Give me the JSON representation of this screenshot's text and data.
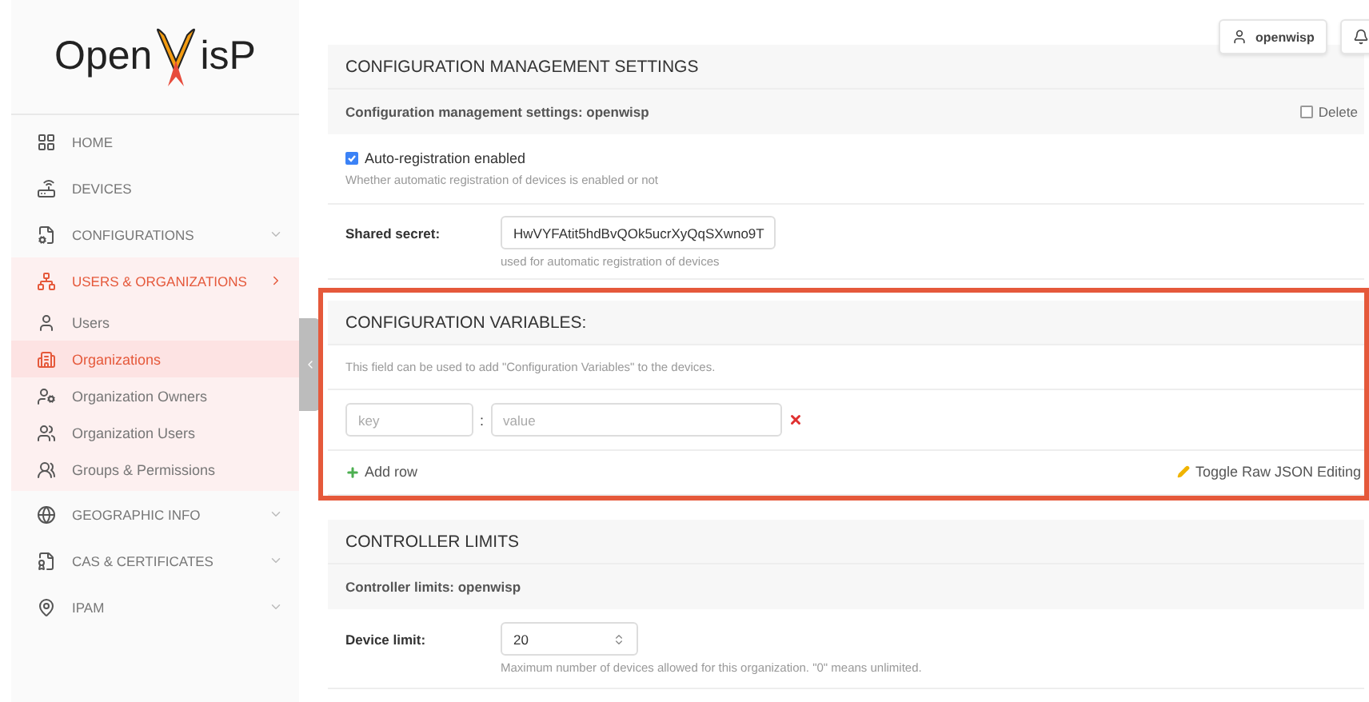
{
  "logo": {
    "before": "Open",
    "after": "isP"
  },
  "sidebar": {
    "items": [
      {
        "label": "HOME",
        "expandable": false,
        "expanded": false
      },
      {
        "label": "DEVICES",
        "expandable": false,
        "expanded": false
      },
      {
        "label": "CONFIGURATIONS",
        "expandable": true,
        "expanded": false
      },
      {
        "label": "USERS & ORGANIZATIONS",
        "expandable": true,
        "expanded": true,
        "children": [
          {
            "label": "Users",
            "selected": false
          },
          {
            "label": "Organizations",
            "selected": true
          },
          {
            "label": "Organization Owners",
            "selected": false
          },
          {
            "label": "Organization Users",
            "selected": false
          },
          {
            "label": "Groups & Permissions",
            "selected": false
          }
        ]
      },
      {
        "label": "GEOGRAPHIC INFO",
        "expandable": true,
        "expanded": false
      },
      {
        "label": "CAS & CERTIFICATES",
        "expandable": true,
        "expanded": false
      },
      {
        "label": "IPAM",
        "expandable": true,
        "expanded": false
      }
    ]
  },
  "user_button": "openwisp",
  "config_settings": {
    "title": "CONFIGURATION MANAGEMENT SETTINGS",
    "subtitle": "Configuration management settings: openwisp",
    "delete_label": "Delete",
    "delete_checked": false,
    "auto_registration": {
      "label": "Auto-registration enabled",
      "checked": true,
      "help": "Whether automatic registration of devices is enabled or not"
    },
    "shared_secret": {
      "label": "Shared secret:",
      "value": "HwVYFAtit5hdBvQOk5ucrXyQqSXwno9T",
      "help": "used for automatic registration of devices"
    }
  },
  "config_variables": {
    "highlighted": true,
    "title": "CONFIGURATION VARIABLES:",
    "description": "This field can be used to add \"Configuration Variables\" to the devices.",
    "rows": [
      {
        "key_placeholder": "key",
        "separator": ":",
        "value_placeholder": "value"
      }
    ],
    "add_row": "Add row",
    "toggle": "Toggle Raw JSON Editing"
  },
  "controller_limits": {
    "title": "CONTROLLER LIMITS",
    "subtitle": "Controller limits: openwisp",
    "device_limit": {
      "label": "Device limit:",
      "value": "20",
      "help": "Maximum number of devices allowed for this organization. \"0\" means unlimited."
    }
  }
}
